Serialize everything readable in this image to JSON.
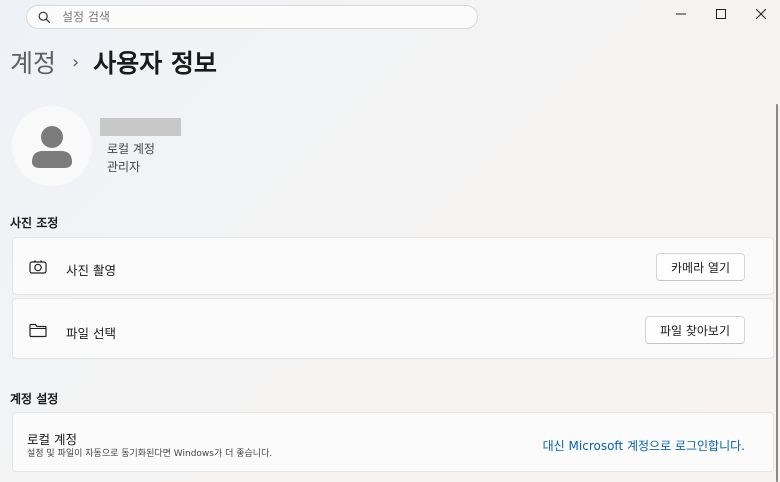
{
  "search": {
    "placeholder": "설정 검색"
  },
  "window_controls": {
    "minimize": "−",
    "maximize": "☐",
    "close": "✕"
  },
  "breadcrumb": {
    "parent": "계정",
    "separator": "›",
    "current": "사용자 정보"
  },
  "profile": {
    "account_type": "로컬 계정",
    "role": "관리자"
  },
  "photo_section": {
    "title": "사진 조정",
    "items": [
      {
        "label": "사진 촬영",
        "button": "카메라 열기",
        "icon": "camera-icon"
      },
      {
        "label": "파일 선택",
        "button": "파일 찾아보기",
        "icon": "folder-icon"
      }
    ]
  },
  "account_section": {
    "title": "계정 설정",
    "local_account": {
      "title": "로컬 계정",
      "description": "설정 및 파일이 자동으로 동기화된다면 Windows가 더 좋습니다.",
      "link": "대신 Microsoft 계정으로 로그인합니다."
    }
  },
  "colors": {
    "link": "#0a5fa8",
    "accent": "#005fb8"
  }
}
